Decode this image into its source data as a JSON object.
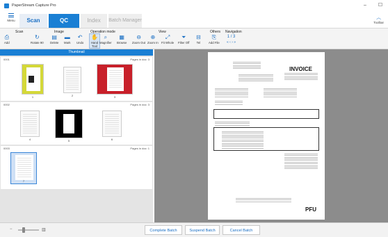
{
  "window": {
    "title": "PaperStream Capture Pro",
    "controls": [
      "–",
      "☐"
    ]
  },
  "tabs": {
    "menu_label": "Menu",
    "scan": "Scan",
    "qc": "QC",
    "index": "Index",
    "batch_manager": "Batch Manager",
    "toolbar_label": "Toolbar"
  },
  "ribbon": {
    "groups": {
      "scan": "Scan",
      "image": "Image",
      "operation_mode": "Operation mode",
      "view": "View",
      "others": "Others",
      "navigation": "Navigation"
    },
    "tools": {
      "add": "Add",
      "rotate": "Rotate 90",
      "delete": "Delete",
      "mark": "Mark",
      "undo": "Undo",
      "hand_tool": "Hand Tool",
      "magnifier": "Magnifier",
      "browse": "Browse",
      "zoom_out": "Zoom Out",
      "zoom_in": "Zoom In",
      "fit_whole": "Fit Whole",
      "filter_off": "Filter Off",
      "tel": "Tel",
      "add_file": "Add File"
    },
    "nav_page": "1 / 3",
    "nav_arrows": "« ‹ › »"
  },
  "thumbnail": {
    "header": "Thumbnail",
    "docs": [
      {
        "name": "0001",
        "pages_info": "Pages in doc: 3",
        "pages": [
          "1",
          "2",
          "3"
        ]
      },
      {
        "name": "0002",
        "pages_info": "Pages in doc: 3",
        "pages": [
          "4",
          "5",
          "6"
        ]
      },
      {
        "name": "0003",
        "pages_info": "Pages in doc: 1",
        "pages": [
          "7"
        ]
      }
    ]
  },
  "invoice": {
    "title": "INVOICE",
    "logo": "PFU"
  },
  "status": {
    "complete_batch": "Complete Batch",
    "suspend_batch": "Suspend Batch",
    "cancel_batch": "Cancel Batch"
  },
  "colors": {
    "accent": "#1a7fd4",
    "yellow_page": "#d4d838",
    "red_page": "#c8202a"
  }
}
